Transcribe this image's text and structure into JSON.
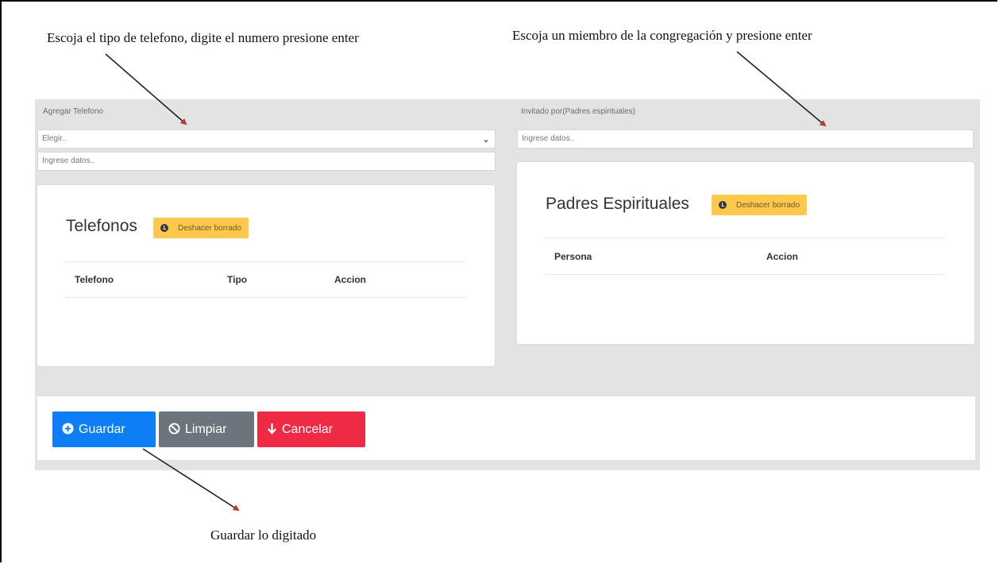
{
  "annotations": {
    "phone_instruction": "Escoja el tipo de telefono,  digite el numero  presione enter",
    "member_instruction": "Escoja un miembro de la congregación y presione enter",
    "save_instruction": "Guardar lo digitado"
  },
  "left_panel": {
    "label": "Agregar Telefono",
    "type_select_value": "Elegir..",
    "number_input_placeholder": "Ingrese datos..",
    "card": {
      "title": "Telefonos",
      "undo_label": "Deshacer borrado",
      "columns": [
        "Telefono",
        "Tipo",
        "Accion"
      ]
    }
  },
  "right_panel": {
    "label": "Invitado por(Padres espirituales)",
    "input_placeholder": "Ingrese datos..",
    "card": {
      "title": "Padres Espirituales",
      "undo_label": "Deshacer borrado",
      "columns": [
        "Persona",
        "Accion"
      ]
    }
  },
  "actions": {
    "save_label": "Guardar",
    "clear_label": "Limpiar",
    "cancel_label": "Cancelar"
  },
  "colors": {
    "save": "#0d7ef6",
    "clear": "#6c757d",
    "cancel": "#ef2a45",
    "warning": "#ffc94d",
    "panel_bg": "#e3e3e3"
  },
  "icons": {
    "save": "plus-circle-icon",
    "clear": "ban-icon",
    "cancel": "arrow-down-icon",
    "undo": "clock-icon"
  }
}
